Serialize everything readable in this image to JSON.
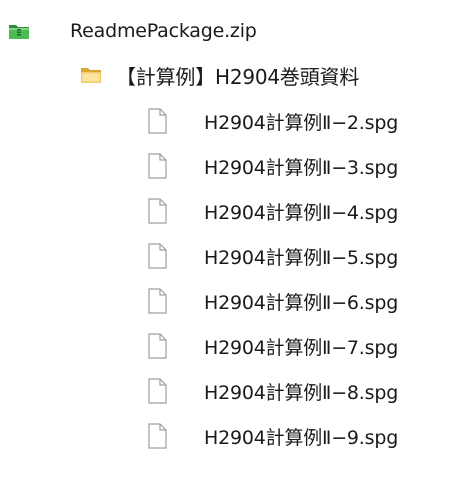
{
  "tree": {
    "root": {
      "label": "ReadmePackage.zip",
      "icon": "zip-folder-icon",
      "icon_color": "#3aa043"
    },
    "folder": {
      "label": "【計算例】H2904巻頭資料",
      "icon": "folder-icon",
      "icon_color": "#e8b84a"
    },
    "files": [
      {
        "label": "H2904計算例Ⅱ−2.spg",
        "icon": "file-icon"
      },
      {
        "label": "H2904計算例Ⅱ−3.spg",
        "icon": "file-icon"
      },
      {
        "label": "H2904計算例Ⅱ−4.spg",
        "icon": "file-icon"
      },
      {
        "label": "H2904計算例Ⅱ−5.spg",
        "icon": "file-icon"
      },
      {
        "label": "H2904計算例Ⅱ−6.spg",
        "icon": "file-icon"
      },
      {
        "label": "H2904計算例Ⅱ−7.spg",
        "icon": "file-icon"
      },
      {
        "label": "H2904計算例Ⅱ−8.spg",
        "icon": "file-icon"
      },
      {
        "label": "H2904計算例Ⅱ−9.spg",
        "icon": "file-icon"
      }
    ]
  }
}
